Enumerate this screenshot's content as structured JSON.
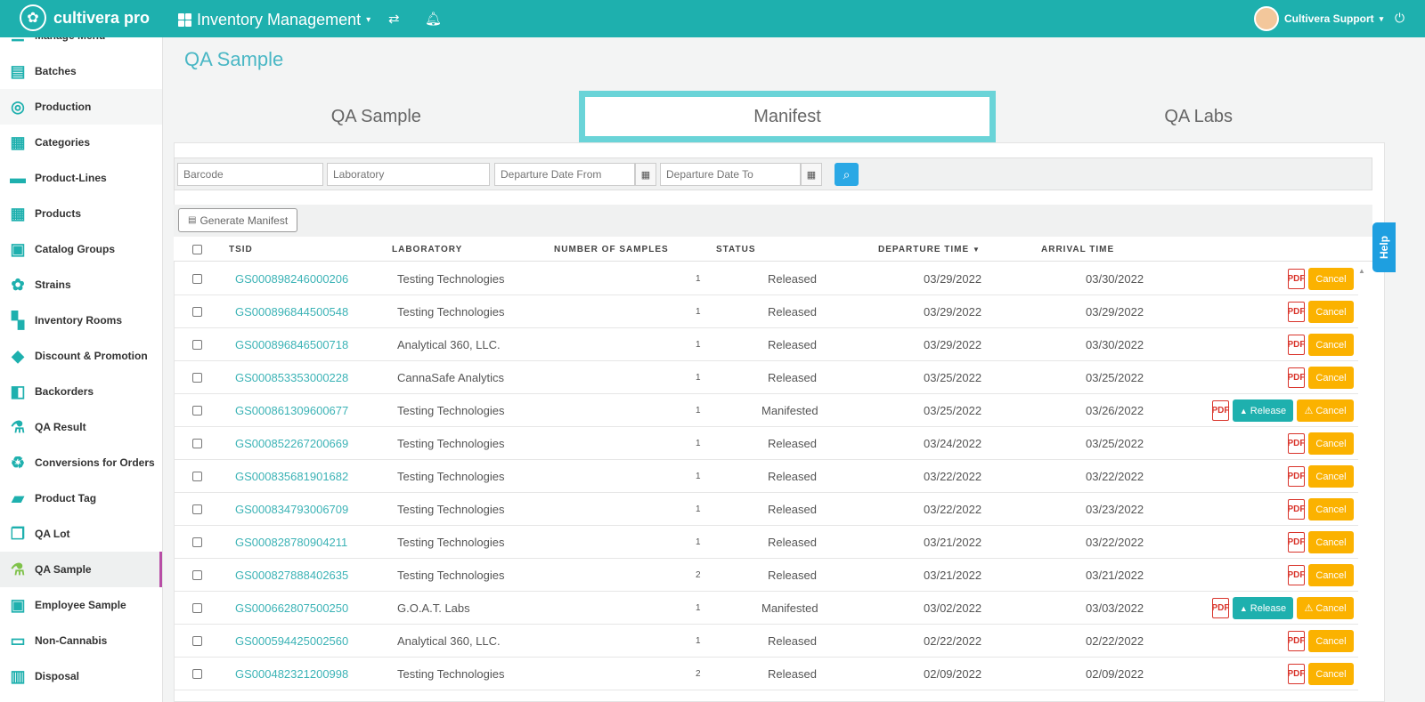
{
  "header": {
    "brand": "cultivera pro",
    "app_title": "Inventory Management",
    "user_name": "Cultivera Support",
    "help_label": "Help"
  },
  "sidebar": {
    "items": [
      {
        "label": "Manage Menu",
        "icon": "menu-icon"
      },
      {
        "label": "Batches",
        "icon": "batches-icon"
      },
      {
        "label": "Production",
        "icon": "production-icon"
      },
      {
        "label": "Categories",
        "icon": "categories-icon"
      },
      {
        "label": "Product-Lines",
        "icon": "product-lines-icon"
      },
      {
        "label": "Products",
        "icon": "products-icon"
      },
      {
        "label": "Catalog Groups",
        "icon": "catalog-groups-icon"
      },
      {
        "label": "Strains",
        "icon": "strains-icon"
      },
      {
        "label": "Inventory Rooms",
        "icon": "inventory-rooms-icon"
      },
      {
        "label": "Discount & Promotion",
        "icon": "tag-icon"
      },
      {
        "label": "Backorders",
        "icon": "backorders-icon"
      },
      {
        "label": "QA Result",
        "icon": "flask-icon"
      },
      {
        "label": "Conversions for Orders",
        "icon": "recycle-icon"
      },
      {
        "label": "Product Tag",
        "icon": "label-icon"
      },
      {
        "label": "QA Lot",
        "icon": "copy-icon"
      },
      {
        "label": "QA Sample",
        "icon": "flask-icon"
      },
      {
        "label": "Employee Sample",
        "icon": "badge-icon"
      },
      {
        "label": "Non-Cannabis",
        "icon": "non-cannabis-icon"
      },
      {
        "label": "Disposal",
        "icon": "trash-icon"
      }
    ]
  },
  "page": {
    "title": "QA Sample",
    "tabs": [
      "QA Sample",
      "Manifest",
      "QA Labs"
    ]
  },
  "filters": {
    "barcode_placeholder": "Barcode",
    "laboratory_placeholder": "Laboratory",
    "date_from_placeholder": "Departure Date From",
    "date_to_placeholder": "Departure Date To"
  },
  "actions": {
    "generate_manifest": "Generate Manifest",
    "release": "Release",
    "cancel": "Cancel"
  },
  "table": {
    "columns": [
      "TSID",
      "LABORATORY",
      "NUMBER OF SAMPLES",
      "STATUS",
      "DEPARTURE TIME",
      "ARRIVAL TIME"
    ],
    "sort_indicator": "▼",
    "rows": [
      {
        "tsid": "GS000898246000206",
        "lab": "Testing Technologies",
        "samples": "1",
        "status": "Released",
        "departure": "03/29/2022",
        "arrival": "03/30/2022",
        "release": false
      },
      {
        "tsid": "GS000896844500548",
        "lab": "Testing Technologies",
        "samples": "1",
        "status": "Released",
        "departure": "03/29/2022",
        "arrival": "03/29/2022",
        "release": false
      },
      {
        "tsid": "GS000896846500718",
        "lab": "Analytical 360, LLC.",
        "samples": "1",
        "status": "Released",
        "departure": "03/29/2022",
        "arrival": "03/30/2022",
        "release": false
      },
      {
        "tsid": "GS000853353000228",
        "lab": "CannaSafe Analytics",
        "samples": "1",
        "status": "Released",
        "departure": "03/25/2022",
        "arrival": "03/25/2022",
        "release": false
      },
      {
        "tsid": "GS000861309600677",
        "lab": "Testing Technologies",
        "samples": "1",
        "status": "Manifested",
        "departure": "03/25/2022",
        "arrival": "03/26/2022",
        "release": true
      },
      {
        "tsid": "GS000852267200669",
        "lab": "Testing Technologies",
        "samples": "1",
        "status": "Released",
        "departure": "03/24/2022",
        "arrival": "03/25/2022",
        "release": false
      },
      {
        "tsid": "GS000835681901682",
        "lab": "Testing Technologies",
        "samples": "1",
        "status": "Released",
        "departure": "03/22/2022",
        "arrival": "03/22/2022",
        "release": false
      },
      {
        "tsid": "GS000834793006709",
        "lab": "Testing Technologies",
        "samples": "1",
        "status": "Released",
        "departure": "03/22/2022",
        "arrival": "03/23/2022",
        "release": false
      },
      {
        "tsid": "GS000828780904211",
        "lab": "Testing Technologies",
        "samples": "1",
        "status": "Released",
        "departure": "03/21/2022",
        "arrival": "03/22/2022",
        "release": false
      },
      {
        "tsid": "GS000827888402635",
        "lab": "Testing Technologies",
        "samples": "2",
        "status": "Released",
        "departure": "03/21/2022",
        "arrival": "03/21/2022",
        "release": false
      },
      {
        "tsid": "GS000662807500250",
        "lab": "G.O.A.T. Labs",
        "samples": "1",
        "status": "Manifested",
        "departure": "03/02/2022",
        "arrival": "03/03/2022",
        "release": true
      },
      {
        "tsid": "GS000594425002560",
        "lab": "Analytical 360, LLC.",
        "samples": "1",
        "status": "Released",
        "departure": "02/22/2022",
        "arrival": "02/22/2022",
        "release": false
      },
      {
        "tsid": "GS000482321200998",
        "lab": "Testing Technologies",
        "samples": "2",
        "status": "Released",
        "departure": "02/09/2022",
        "arrival": "02/09/2022",
        "release": false
      }
    ]
  },
  "colors": {
    "brand": "#1eb0ae",
    "accent_tab_border": "#6ad4d8",
    "cancel": "#fbb200",
    "pdf": "#d9342b",
    "search_button": "#2aa8e5",
    "help": "#1e9fe0"
  }
}
